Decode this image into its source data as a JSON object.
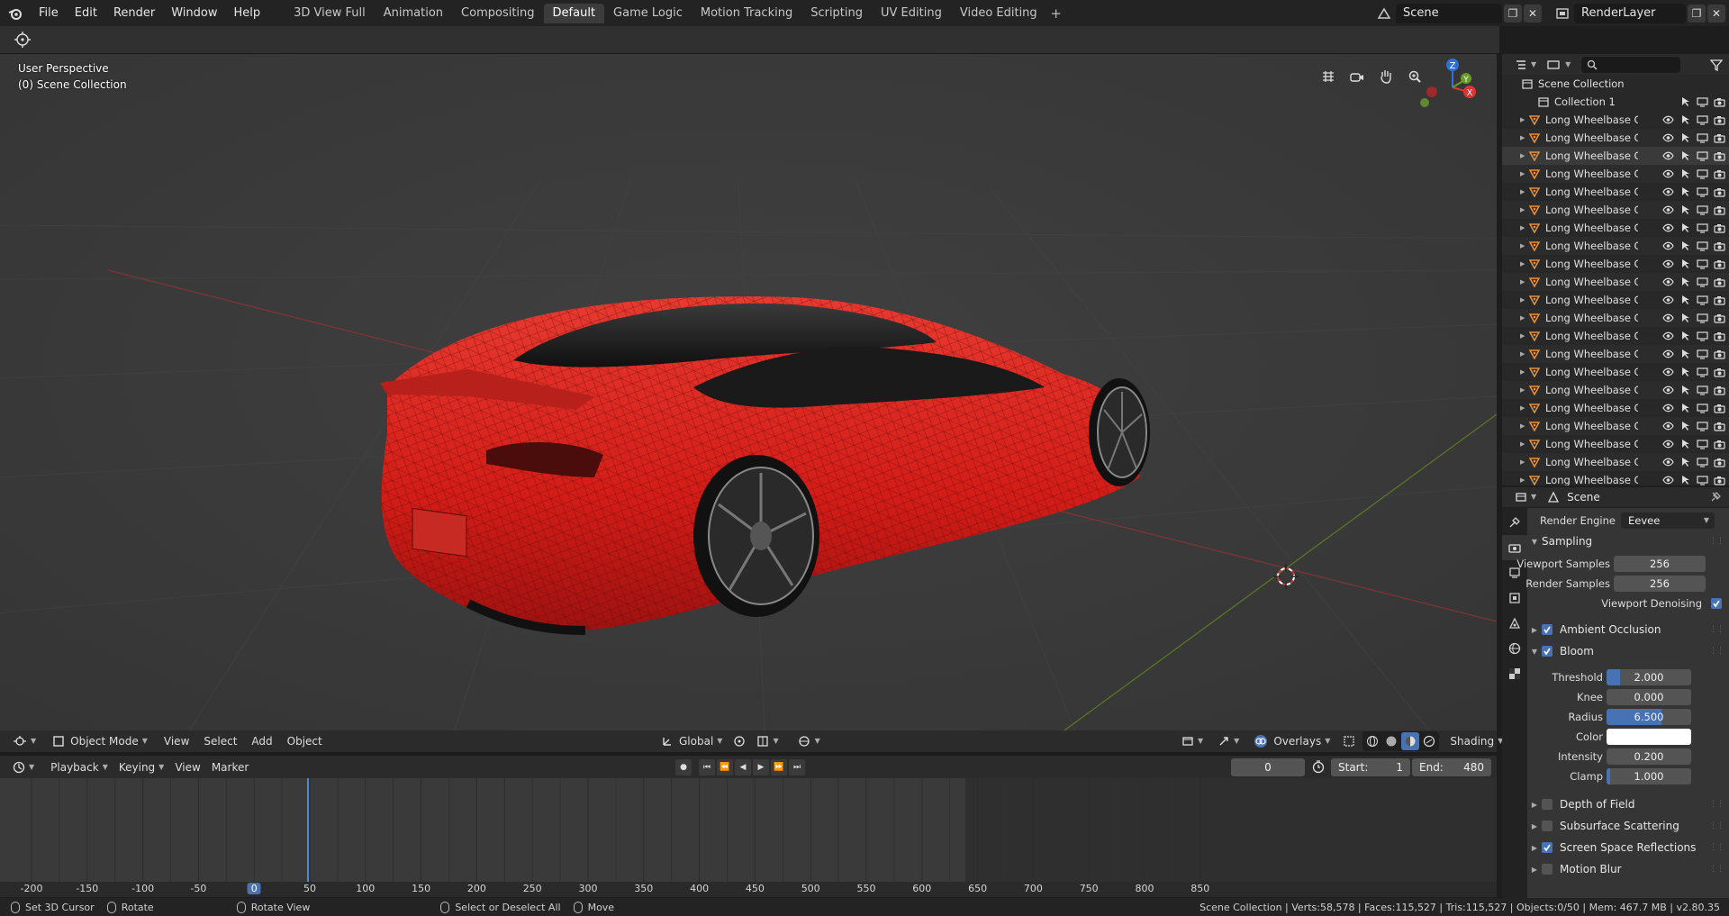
{
  "topbar": {
    "menus": [
      "File",
      "Edit",
      "Render",
      "Window",
      "Help"
    ],
    "workspaces": [
      "3D View Full",
      "Animation",
      "Compositing",
      "Default",
      "Game Logic",
      "Motion Tracking",
      "Scripting",
      "UV Editing",
      "Video Editing"
    ],
    "active_workspace": "Default",
    "add_label": "+",
    "scene_name": "Scene",
    "layer_name": "RenderLayer"
  },
  "viewport": {
    "perspective_label": "User Perspective",
    "collection_label": "(0) Scene Collection",
    "gizmo": {
      "z": "Z",
      "y": "Y",
      "x": "X"
    },
    "body_color": "#d41c17"
  },
  "viewport_header": {
    "mode": "Object Mode",
    "menus": [
      "View",
      "Select",
      "Add",
      "Object"
    ],
    "orientation": "Global",
    "overlays": "Overlays",
    "shading": "Shading"
  },
  "timeline_header": {
    "menus": [
      "Playback",
      "Keying",
      "View",
      "Marker"
    ],
    "current_frame": "0",
    "start_label": "Start:",
    "start": "1",
    "end_label": "End:",
    "end": "480"
  },
  "timeline": {
    "ticks": [
      "-200",
      "-150",
      "-100",
      "-50",
      "0",
      "50",
      "100",
      "150",
      "200",
      "250",
      "300",
      "350",
      "400",
      "450",
      "500",
      "550",
      "600",
      "650",
      "700",
      "750",
      "800",
      "850"
    ],
    "current": "0"
  },
  "outliner": {
    "root": "Scene Collection",
    "collection": "Collection 1",
    "object_name": "Long Wheelbase Car",
    "object_count_rows": 21
  },
  "properties": {
    "title": "Scene",
    "render_engine_label": "Render Engine",
    "render_engine": "Eevee",
    "sampling": "Sampling",
    "viewport_samples_label": "Viewport Samples",
    "viewport_samples": "256",
    "render_samples_label": "Render Samples",
    "render_samples": "256",
    "viewport_denoising": "Viewport Denoising",
    "ambient_occlusion": "Ambient Occlusion",
    "bloom": "Bloom",
    "threshold_label": "Threshold",
    "threshold": "2.000",
    "knee_label": "Knee",
    "knee": "0.000",
    "radius_label": "Radius",
    "radius": "6.500",
    "color_label": "Color",
    "intensity_label": "Intensity",
    "intensity": "0.200",
    "clamp_label": "Clamp",
    "clamp": "1.000",
    "depth_of_field": "Depth of Field",
    "subsurface_scattering": "Subsurface Scattering",
    "screen_space_reflections": "Screen Space Reflections",
    "motion_blur": "Motion Blur"
  },
  "statusbar": {
    "hint1": "Set 3D Cursor",
    "hint2": "Rotate",
    "hint3": "Rotate View",
    "hint4": "Select or Deselect All",
    "hint5": "Move",
    "stats": "Scene Collection | Verts:58,578 | Faces:115,527 | Tris:115,527 | Objects:0/50 | Mem: 467.7 MB | v2.80.35"
  }
}
